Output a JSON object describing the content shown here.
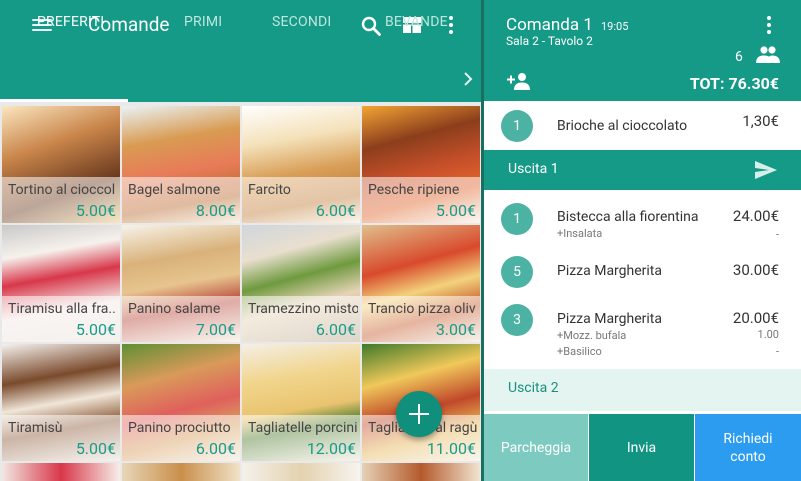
{
  "app": {
    "title": "Comande"
  },
  "tabs": [
    {
      "label": "PREFERITI"
    },
    {
      "label": "PRIMI"
    },
    {
      "label": "SECONDI"
    },
    {
      "label": "BEVANDE"
    }
  ],
  "products": [
    {
      "name": "Tortino al cioccol",
      "price": "5.00€"
    },
    {
      "name": "Bagel salmone",
      "price": "8.00€"
    },
    {
      "name": "Farcito",
      "price": "6.00€"
    },
    {
      "name": "Pesche ripiene",
      "price": "5.00€"
    },
    {
      "name": "Tiramisu alla fra..",
      "price": "5.00€"
    },
    {
      "name": "Panino salame",
      "price": "7.00€"
    },
    {
      "name": "Tramezzino misto",
      "price": "6.00€"
    },
    {
      "name": "Trancio pizza oliv",
      "price": "3.00€"
    },
    {
      "name": "Tiramisù",
      "price": "5.00€"
    },
    {
      "name": "Panino prociutto",
      "price": "6.00€"
    },
    {
      "name": "Tagliatelle porcini",
      "price": "12.00€"
    },
    {
      "name": "Tagliatelle al ragù",
      "price": "11.00€"
    }
  ],
  "order": {
    "title": "Comanda 1",
    "time": "19:05",
    "table": "Sala 2 - Tavolo 2",
    "guests": "6",
    "total": "TOT: 76.30€",
    "first_item": {
      "qty": "1",
      "name": "Brioche al cioccolato",
      "price": "1,30€"
    },
    "course1": {
      "label": "Uscita 1"
    },
    "course1_items": [
      {
        "qty": "1",
        "name": "Bistecca alla fiorentina",
        "price": "24.00€",
        "mods": [
          {
            "text": "+Insalata",
            "price": "-"
          }
        ]
      },
      {
        "qty": "5",
        "name": "Pizza Margherita",
        "price": "30.00€",
        "mods": []
      },
      {
        "qty": "3",
        "name": "Pizza Margherita",
        "price": "20.00€",
        "mods": [
          {
            "text": "+Mozz. bufala",
            "price": "1.00"
          },
          {
            "text": "+Basilico",
            "price": "-"
          }
        ]
      }
    ],
    "course2": {
      "label": "Uscita 2"
    }
  },
  "actions": {
    "park": "Parcheggia",
    "send": "Invia",
    "bill_line1": "Richiedi",
    "bill_line2": "conto"
  },
  "icons": {
    "menu": "hamburger-icon",
    "search": "search-icon",
    "layout": "layout-icon",
    "more": "more-vert-icon",
    "next": "chevron-right-icon",
    "add": "plus-icon",
    "people": "people-icon",
    "add_person": "person-add-icon",
    "send": "send-icon"
  },
  "colors": {
    "primary": "#149a87",
    "primary_dark": "#0f8f7c",
    "accent_blue": "#2b9cf0",
    "qty_badge": "#4cb3a4",
    "park_button": "#7dcbc0"
  }
}
